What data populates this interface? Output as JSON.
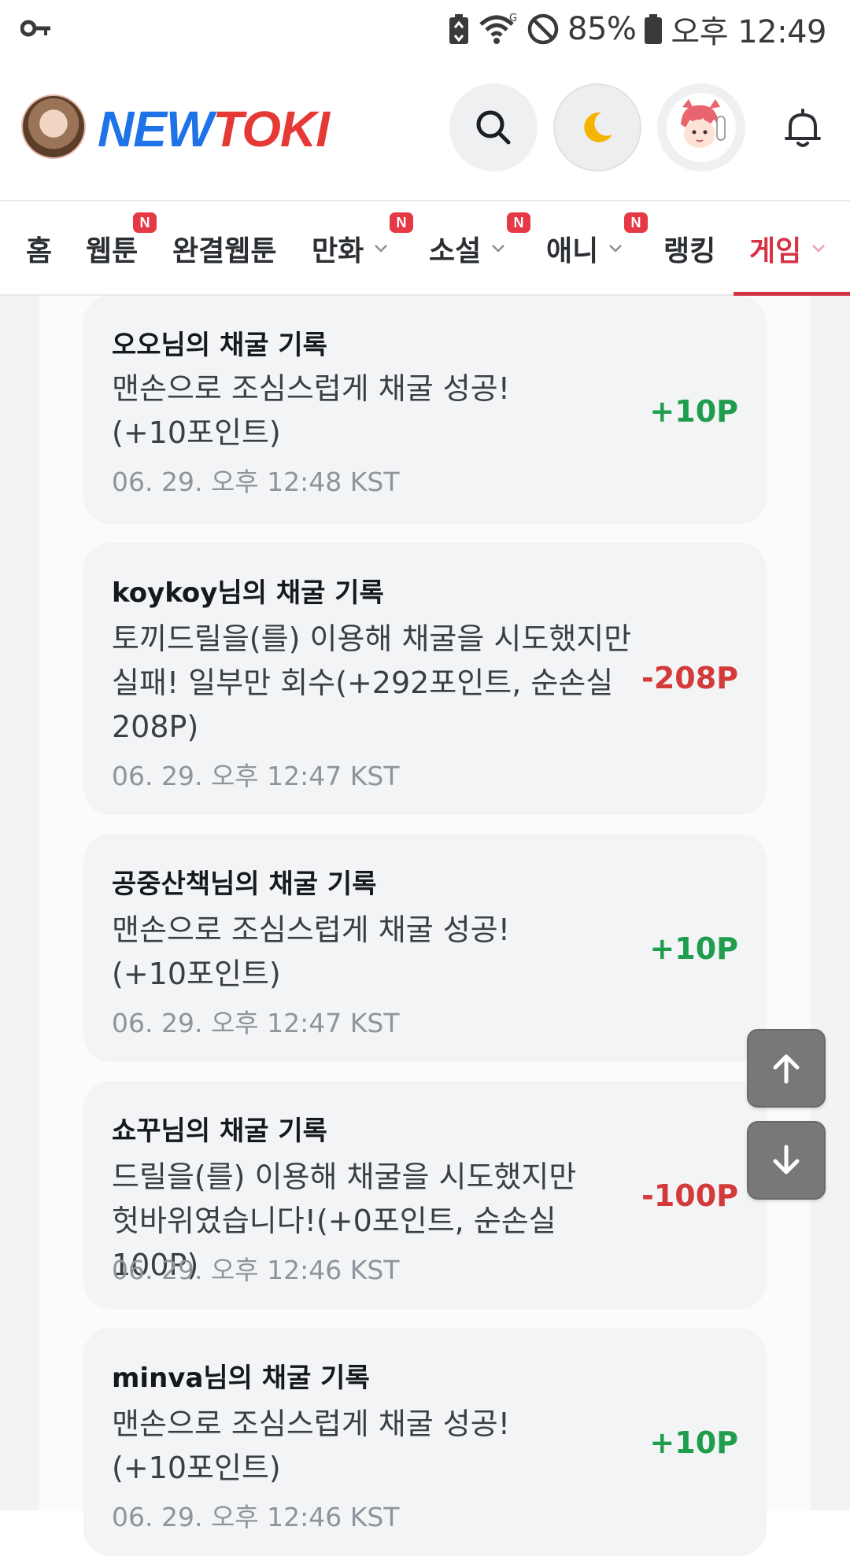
{
  "status_bar": {
    "battery_percent": "85%",
    "time": "오후 12:49",
    "icons": [
      "key-icon",
      "battery-saver-icon",
      "wifi-icon",
      "do-not-disturb-icon",
      "battery-icon"
    ]
  },
  "header": {
    "logo_part1": "NEW",
    "logo_part2": "TOKI",
    "icons": [
      "search-icon",
      "moon-icon",
      "profile-avatar",
      "bell-icon"
    ]
  },
  "nav": {
    "items": [
      {
        "label": "홈",
        "badge": ""
      },
      {
        "label": "웹툰",
        "badge": "N"
      },
      {
        "label": "완결웹툰",
        "badge": ""
      },
      {
        "label": "만화",
        "badge": "N"
      },
      {
        "label": "소설",
        "badge": "N"
      },
      {
        "label": "애니",
        "badge": "N"
      },
      {
        "label": "랭킹",
        "badge": ""
      },
      {
        "label": "게임",
        "badge": "",
        "active": true
      }
    ]
  },
  "records": [
    {
      "title": "오오님의 채굴 기록",
      "body": "맨손으로 조심스럽게 채굴 성공!(+10포인트)",
      "time": "06. 29. 오후 12:48 KST",
      "points": "+10P",
      "type": "plus"
    },
    {
      "title": "koykoy님의 채굴 기록",
      "body": "토끼드릴을(를) 이용해 채굴을 시도했지만 실패! 일부만 회수(+292포인트, 순손실 208P)",
      "time": "06. 29. 오후 12:47 KST",
      "points": "-208P",
      "type": "minus"
    },
    {
      "title": "공중산책님의 채굴 기록",
      "body": "맨손으로 조심스럽게 채굴 성공!(+10포인트)",
      "time": "06. 29. 오후 12:47 KST",
      "points": "+10P",
      "type": "plus"
    },
    {
      "title": "쇼꾸님의 채굴 기록",
      "body": "드릴을(를) 이용해 채굴을 시도했지만 헛바위였습니다!(+0포인트, 순손실 100P)",
      "time": "06. 29. 오후 12:46 KST",
      "points": "-100P",
      "type": "minus"
    },
    {
      "title": "minva님의 채굴 기록",
      "body": "맨손으로 조심스럽게 채굴 성공!(+10포인트)",
      "time": "06. 29. 오후 12:46 KST",
      "points": "+10P",
      "type": "plus"
    }
  ],
  "floating": {
    "up_icon": "arrow-up-icon",
    "down_icon": "arrow-down-icon"
  },
  "colors": {
    "accent": "#d63345",
    "plus": "#1f9d4c",
    "minus": "#d33a3a",
    "logo_blue": "#1e73e8",
    "logo_red": "#e53935"
  }
}
